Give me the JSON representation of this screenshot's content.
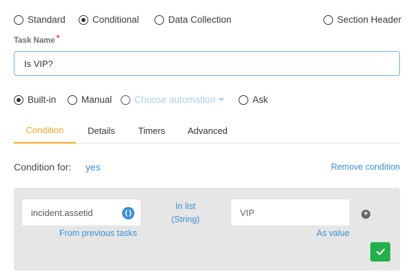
{
  "task_type": {
    "options": [
      {
        "label": "Standard",
        "selected": false
      },
      {
        "label": "Conditional",
        "selected": true
      },
      {
        "label": "Data Collection",
        "selected": false
      },
      {
        "label": "Section Header",
        "selected": false
      }
    ]
  },
  "task_name": {
    "label": "Task Name",
    "required_mark": "*",
    "value": "Is VIP?"
  },
  "mode": {
    "options": [
      {
        "label": "Built-in",
        "selected": true
      },
      {
        "label": "Manual",
        "selected": false
      },
      {
        "label": "Choose automation",
        "selected": false,
        "disabled": true
      },
      {
        "label": "Ask",
        "selected": false
      }
    ]
  },
  "tabs": [
    {
      "label": "Condition",
      "active": true
    },
    {
      "label": "Details",
      "active": false
    },
    {
      "label": "Timers",
      "active": false
    },
    {
      "label": "Advanced",
      "active": false
    }
  ],
  "condition": {
    "for_label": "Condition for:",
    "for_value": "yes",
    "remove_label": "Remove condition",
    "lhs_value": "incident.assetid",
    "lhs_source": "From previous tasks",
    "operator_line1": "In list",
    "operator_line2": "(String)",
    "rhs_value": "VIP",
    "rhs_source": "As value",
    "curly_icon_text": "{}"
  },
  "colors": {
    "accent_orange": "#f5a623",
    "link_blue": "#3a8fd6",
    "save_green": "#21b04b",
    "required_red": "#e53935"
  }
}
